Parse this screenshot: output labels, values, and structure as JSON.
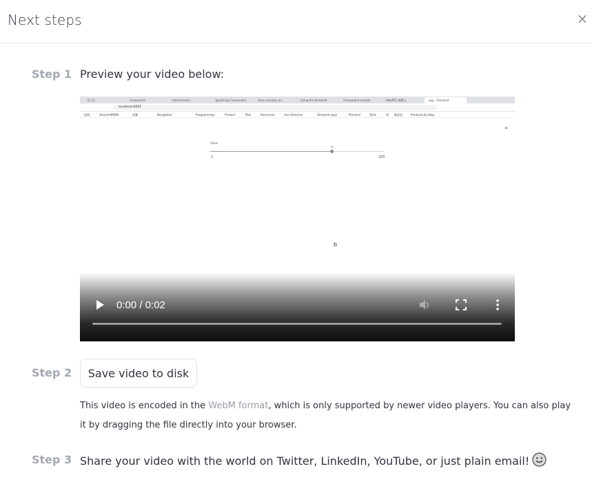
{
  "dialog": {
    "title": "Next steps",
    "close_glyph": "×"
  },
  "step1": {
    "label": "Step 1",
    "text": "Preview your video below:"
  },
  "video": {
    "time_display": "0:00 / 0:02",
    "progress": 0,
    "recorded_screen": {
      "tabs": [
        "(1) 31 ...",
        "Component",
        "InteractiveGr...",
        "TypeScript Component",
        "Save and play on...",
        "Using the Streamlit",
        "Component sample",
        "WebRTC 的默认",
        "app · Streamlit"
      ],
      "url": "localhost:8501",
      "bookmarks": [
        "应用",
        "StreamlitMDN",
        "文章",
        "Navigation",
        "Programming",
        "Product",
        "Mail",
        "Resources",
        "Vue+Electron",
        "Streamlit apps",
        "Personal",
        "Tools",
        "UI",
        "高谷谷",
        "Productivity Blog"
      ],
      "slider_label": "Value",
      "slider_value": "70",
      "slider_min": "1",
      "slider_max": "100",
      "output_text": "b"
    }
  },
  "step2": {
    "label": "Step 2",
    "button_label": "Save video to disk",
    "info_before": "This video is encoded in the ",
    "info_link": "WebM format",
    "info_after": ", which is only supported by newer video players. You can also play it by dragging the file directly into your browser."
  },
  "step3": {
    "label": "Step 3",
    "text": "Share your video with the world on Twitter, LinkedIn, YouTube, or just plain email!"
  },
  "colors": {
    "step_label": "#a3a8b4",
    "text": "#31333f",
    "link": "#9a9ca6",
    "border": "#e0e1e6"
  },
  "icons": [
    "close-icon",
    "play-icon",
    "volume-icon",
    "fullscreen-icon",
    "more-options-icon",
    "smile-emoji-icon"
  ]
}
